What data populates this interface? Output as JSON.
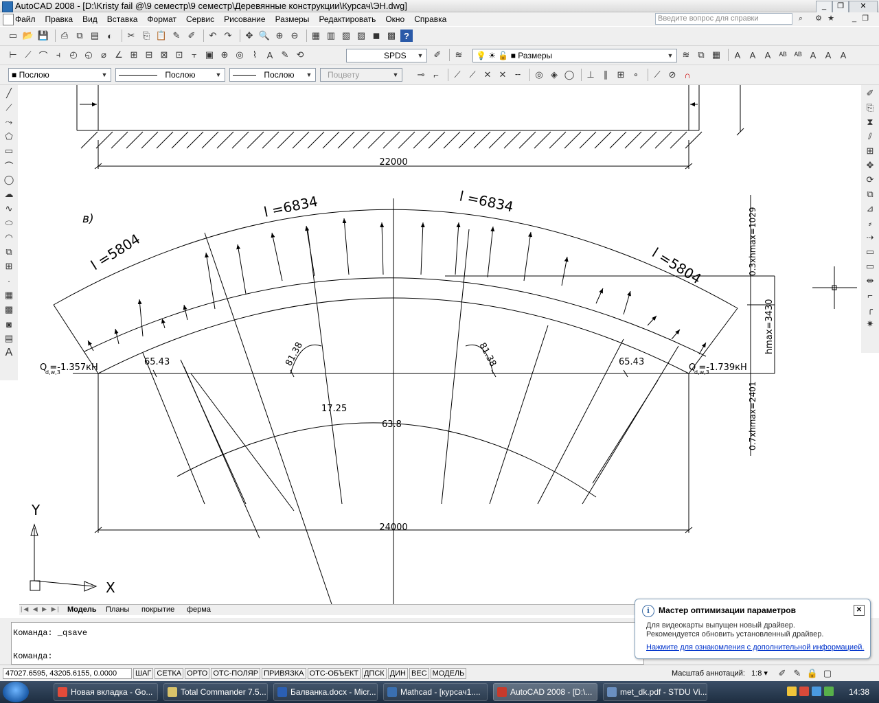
{
  "window": {
    "title": "AutoCAD 2008 - [D:\\Kristy fail @\\9 семестр\\9 семестр\\Деревянные конструкции\\Курсач\\ЭН.dwg]"
  },
  "menu": [
    "Файл",
    "Правка",
    "Вид",
    "Вставка",
    "Формат",
    "Сервис",
    "Рисование",
    "Размеры",
    "Редактировать",
    "Окно",
    "Справка"
  ],
  "help_placeholder": "Введите вопрос для справки",
  "toolbar": {
    "dimstyle": "SPDS",
    "layer": "Размеры",
    "color": "Послою",
    "linetype": "Послою",
    "lineweight": "Послою",
    "plotstyle": "Поцвету"
  },
  "drawing": {
    "label_v": "в)",
    "dim_top": "22000",
    "dim_bottom": "24000",
    "len_left_outer": "l =5804",
    "len_left_mid": "l =6834",
    "len_right_mid": "l =6834",
    "len_right_outer": "l =5804",
    "angle_left": "65.43",
    "angle_right": "65.43",
    "angle_center_left": "81.38",
    "angle_center_right": "81.38",
    "arc_angle": "17.25",
    "arc_center": "63.8",
    "load_left": "Q      =-1.357кН",
    "load_left_sub": "d,w,3",
    "load_right": "Q      =-1.739кН",
    "load_right_sub": "d,w,3",
    "h_upper": "0.3xhmax=1029",
    "h_max": "hmax=3430",
    "h_lower": "0.7xhmax=2401",
    "ucs_x": "X",
    "ucs_y": "Y"
  },
  "tabs": [
    "Модель",
    "Планы",
    "покрытие",
    "ферма"
  ],
  "command": {
    "line1": "Команда:  _qsave",
    "line2": "Команда:"
  },
  "balloon": {
    "title": "Мастер оптимизации параметров",
    "line1": "Для видеокарты выпущен новый драйвер.",
    "line2": "Рекомендуется обновить установленный драйвер.",
    "link": "Нажмите для ознакомления с дополнительной информацией."
  },
  "status": {
    "coords": "47027.6595, 43205.6155, 0.0000",
    "toggles": [
      "ШАГ",
      "СЕТКА",
      "ОРТО",
      "ОТС-ПОЛЯР",
      "ПРИВЯЗКА",
      "ОТС-ОБЪЕКТ",
      "ДПСК",
      "ДИН",
      "ВЕС",
      "МОДЕЛЬ"
    ],
    "annotation_scale_label": "Масштаб аннотаций:",
    "annotation_scale": "1:8"
  },
  "taskbar": {
    "tasks": [
      {
        "label": "Новая вкладка - Go...",
        "color": "#e34b3a"
      },
      {
        "label": "Total Commander 7.5...",
        "color": "#d9c36a"
      },
      {
        "label": "Балванка.docx - Micr...",
        "color": "#2b5fb3"
      },
      {
        "label": "Mathcad - [курсач1....",
        "color": "#3a6fb0"
      },
      {
        "label": "AutoCAD 2008 - [D:\\...",
        "color": "#c73a2b"
      },
      {
        "label": "met_dk.pdf - STDU Vi...",
        "color": "#6a8fc0"
      }
    ],
    "clock": "14:38"
  }
}
